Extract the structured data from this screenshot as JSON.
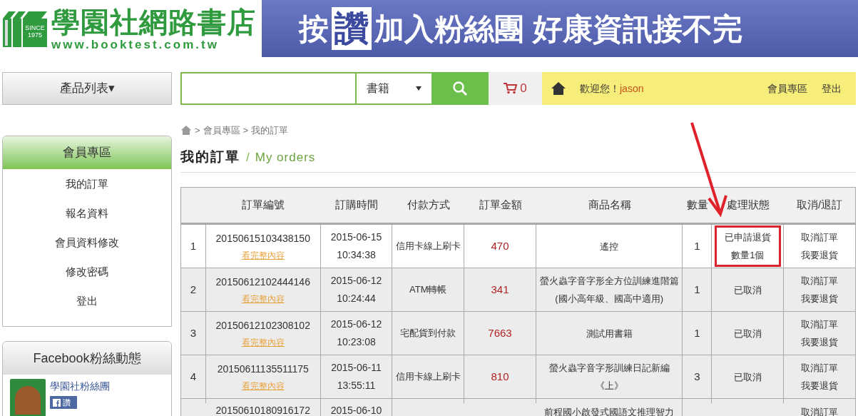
{
  "logo": {
    "title": "學園社網路書店",
    "url": "www.booktest.com.tw",
    "badge": "SINCE 1975"
  },
  "banner": {
    "before": "按",
    "stamp": "讚",
    "after": "加入粉絲團 好康資訊接不完"
  },
  "nav": {
    "product_menu": "產品列表▾",
    "category": "書籍",
    "cart_count": "0",
    "welcome": "歡迎您！",
    "user": "jason",
    "links": [
      "會員專區",
      "登出"
    ]
  },
  "breadcrumb": {
    "separator": ">",
    "items": [
      "會員專區",
      "我的訂單"
    ]
  },
  "page_title": {
    "main": "我的訂單",
    "divider": "/",
    "sub": "My orders"
  },
  "sidebar": {
    "title": "會員專區",
    "items": [
      {
        "label": "我的訂單"
      },
      {
        "label": "報名資料"
      },
      {
        "label": "會員資料修改"
      },
      {
        "label": "修改密碼"
      },
      {
        "label": "登出"
      }
    ]
  },
  "facebook": {
    "title": "Facebook粉絲動態",
    "page_name": "學園社粉絲團",
    "like": "讚"
  },
  "table": {
    "columns": [
      "訂單編號",
      "訂購時間",
      "付款方式",
      "訂單金額",
      "商品名稱",
      "數量",
      "處理狀態",
      "取消/退訂"
    ],
    "rows": [
      {
        "index": "1",
        "order_no": "20150615103438150",
        "detail_link": "看完整內容",
        "date": "2015-06-15",
        "time": "10:34:38",
        "payment": "信用卡線上刷卡",
        "amount": "470",
        "product": "遙控",
        "qty": "1",
        "status": [
          "已申請退貨",
          "數量1個"
        ],
        "actions": [
          "取消訂單",
          "我要退貨"
        ],
        "selected": true,
        "highlighted": true
      },
      {
        "index": "2",
        "order_no": "20150612102444146",
        "detail_link": "看完整內容",
        "date": "2015-06-12",
        "time": "10:24:44",
        "payment": "ATM轉帳",
        "amount": "341",
        "product": "螢火蟲字音字形全方位訓練進階篇(國小高年級、國高中適用)",
        "qty": "1",
        "status": [
          "已取消"
        ],
        "actions": [
          "取消訂單",
          "我要退貨"
        ],
        "selected": false,
        "highlighted": false
      },
      {
        "index": "3",
        "order_no": "20150612102308102",
        "detail_link": "看完整內容",
        "date": "2015-06-12",
        "time": "10:23:08",
        "payment": "宅配貨到付款",
        "amount": "7663",
        "product": "測試用書籍",
        "qty": "1",
        "status": [
          "已取消"
        ],
        "actions": [
          "取消訂單",
          "我要退貨"
        ],
        "selected": false,
        "highlighted": false
      },
      {
        "index": "4",
        "order_no": "20150611135511175",
        "detail_link": "看完整內容",
        "date": "2015-06-11",
        "time": "13:55:11",
        "payment": "信用卡線上刷卡",
        "amount": "810",
        "product": "螢火蟲字音字形訓練日記新編《上》",
        "qty": "3",
        "status": [
          "已取消"
        ],
        "actions": [
          "取消訂單",
          "我要退貨"
        ],
        "selected": false,
        "highlighted": false
      },
      {
        "partial": true,
        "order_no": "20150610180916172",
        "date": "2015-06-10",
        "product": "前程國小啟發式國語文推理智力",
        "actions": [
          "取消訂單"
        ],
        "selected": false
      }
    ]
  },
  "annotation": {
    "kind": "arrow"
  }
}
